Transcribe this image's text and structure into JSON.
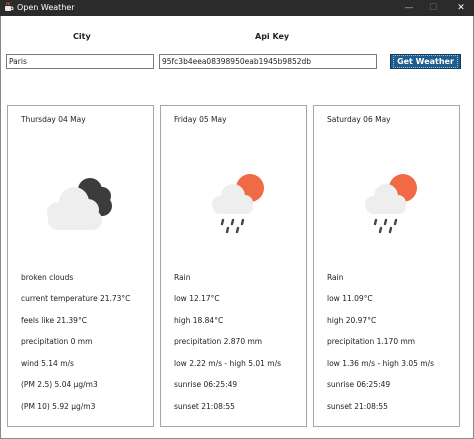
{
  "window": {
    "title": "Open Weather",
    "controls": {
      "minimize": "—",
      "maximize": "☐",
      "close": "✕"
    }
  },
  "form": {
    "city_label": "City",
    "city_value": "Paris",
    "apikey_label": "Api Key",
    "apikey_value": "95fc3b4eea08398950eab1945b9852db",
    "button_label": "Get Weather"
  },
  "colors": {
    "accent_button": "#1f5e8c",
    "sun": "#ef6a45",
    "dark_cloud": "#3c3c3c",
    "light_cloud": "#eeeeee",
    "rain": "#444444"
  },
  "forecast": [
    {
      "date": "Thursday 04 May",
      "icon": "broken-clouds-icon",
      "lines": [
        "broken clouds",
        "current temperature 21.73°C",
        "feels like 21.39°C",
        "precipitation 0 mm",
        "wind 5.14 m/s",
        "(PM 2.5) 5.04 µg/m3",
        "(PM 10) 5.92 µg/m3"
      ]
    },
    {
      "date": "Friday 05 May",
      "icon": "rain-sun-icon",
      "lines": [
        "Rain",
        "low 12.17°C",
        "high 18.84°C",
        "precipitation 2.870 mm",
        "low 2.22 m/s - high 5.01 m/s",
        "sunrise 06:25:49",
        "sunset  21:08:55"
      ]
    },
    {
      "date": "Saturday 06 May",
      "icon": "rain-sun-icon",
      "lines": [
        "Rain",
        "low 11.09°C",
        "high 20.97°C",
        "precipitation 1.170 mm",
        "low 1.36 m/s - high 3.05 m/s",
        "sunrise 06:25:49",
        "sunset  21:08:55"
      ]
    }
  ]
}
